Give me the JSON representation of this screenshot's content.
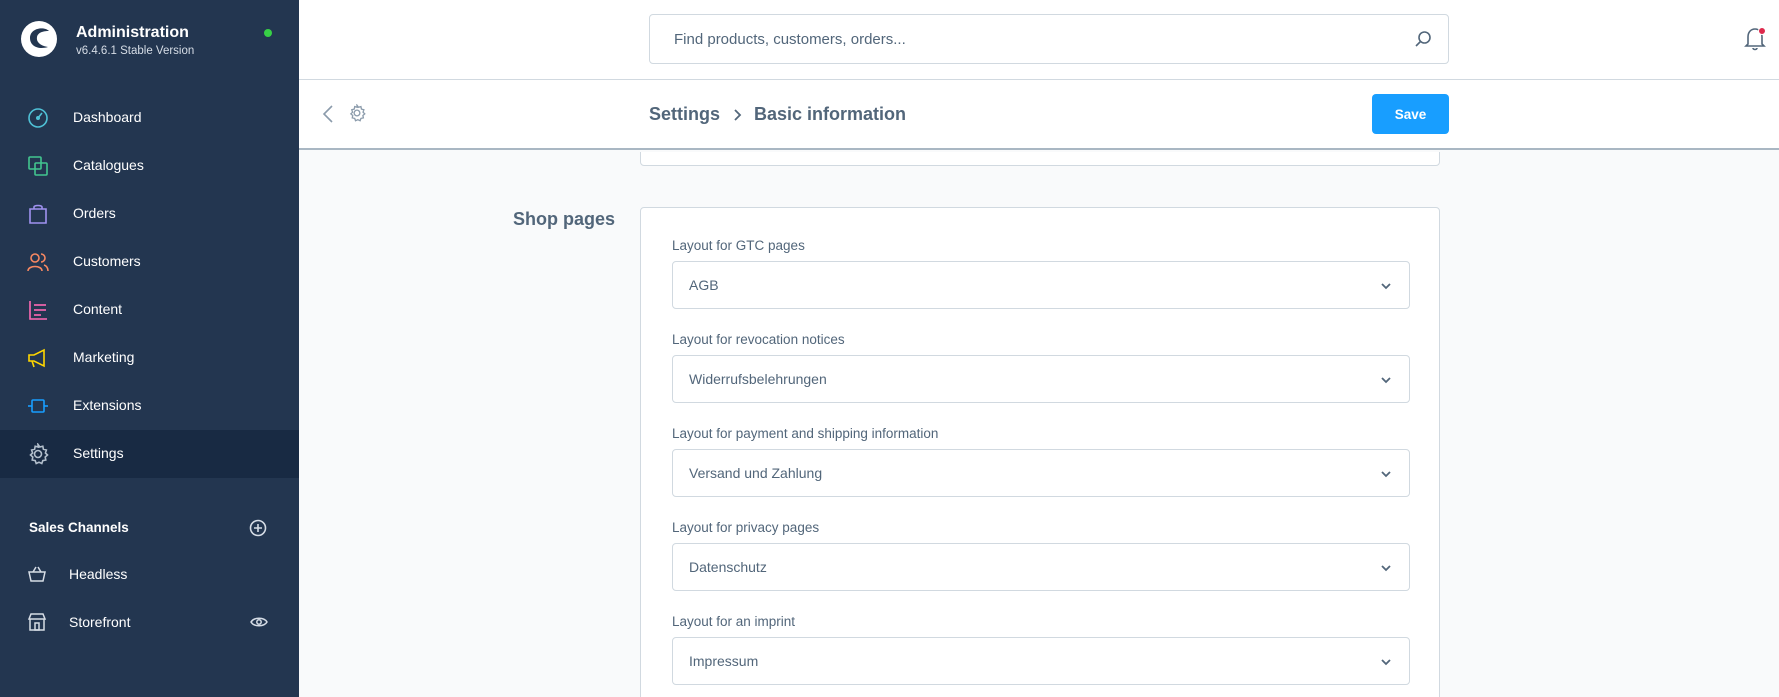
{
  "app": {
    "title": "Administration",
    "version": "v6.4.6.1 Stable Version",
    "status_color": "#37d046"
  },
  "sidebar": {
    "items": [
      {
        "label": "Dashboard",
        "icon": "dashboard-icon",
        "color": "#4fc1d6"
      },
      {
        "label": "Catalogues",
        "icon": "catalogues-icon",
        "color": "#42c68f"
      },
      {
        "label": "Orders",
        "icon": "orders-icon",
        "color": "#a092f0"
      },
      {
        "label": "Customers",
        "icon": "customers-icon",
        "color": "#f88962"
      },
      {
        "label": "Content",
        "icon": "content-icon",
        "color": "#ff68b4"
      },
      {
        "label": "Marketing",
        "icon": "marketing-icon",
        "color": "#ffd700"
      },
      {
        "label": "Extensions",
        "icon": "extensions-icon",
        "color": "#189eff"
      },
      {
        "label": "Settings",
        "icon": "settings-icon",
        "color": "#b3bfcc",
        "active": true
      }
    ],
    "sales_channels": {
      "heading": "Sales Channels",
      "items": [
        {
          "label": "Headless",
          "icon": "basket-icon"
        },
        {
          "label": "Storefront",
          "icon": "storefront-icon"
        }
      ]
    }
  },
  "topbar": {
    "search_placeholder": "Find products, customers, orders..."
  },
  "header": {
    "breadcrumb": [
      "Settings",
      "Basic information"
    ],
    "save_label": "Save"
  },
  "main": {
    "section_title": "Shop pages",
    "fields": [
      {
        "label": "Layout for GTC pages",
        "value": "AGB"
      },
      {
        "label": "Layout for revocation notices",
        "value": "Widerrufsbelehrungen"
      },
      {
        "label": "Layout for payment and shipping information",
        "value": "Versand und Zahlung"
      },
      {
        "label": "Layout for privacy pages",
        "value": "Datenschutz"
      },
      {
        "label": "Layout for an imprint",
        "value": "Impressum"
      }
    ]
  },
  "colors": {
    "sidebar_bg": "#233650",
    "sidebar_active_bg": "#182a43",
    "primary": "#189eff",
    "notification": "#de294c"
  }
}
